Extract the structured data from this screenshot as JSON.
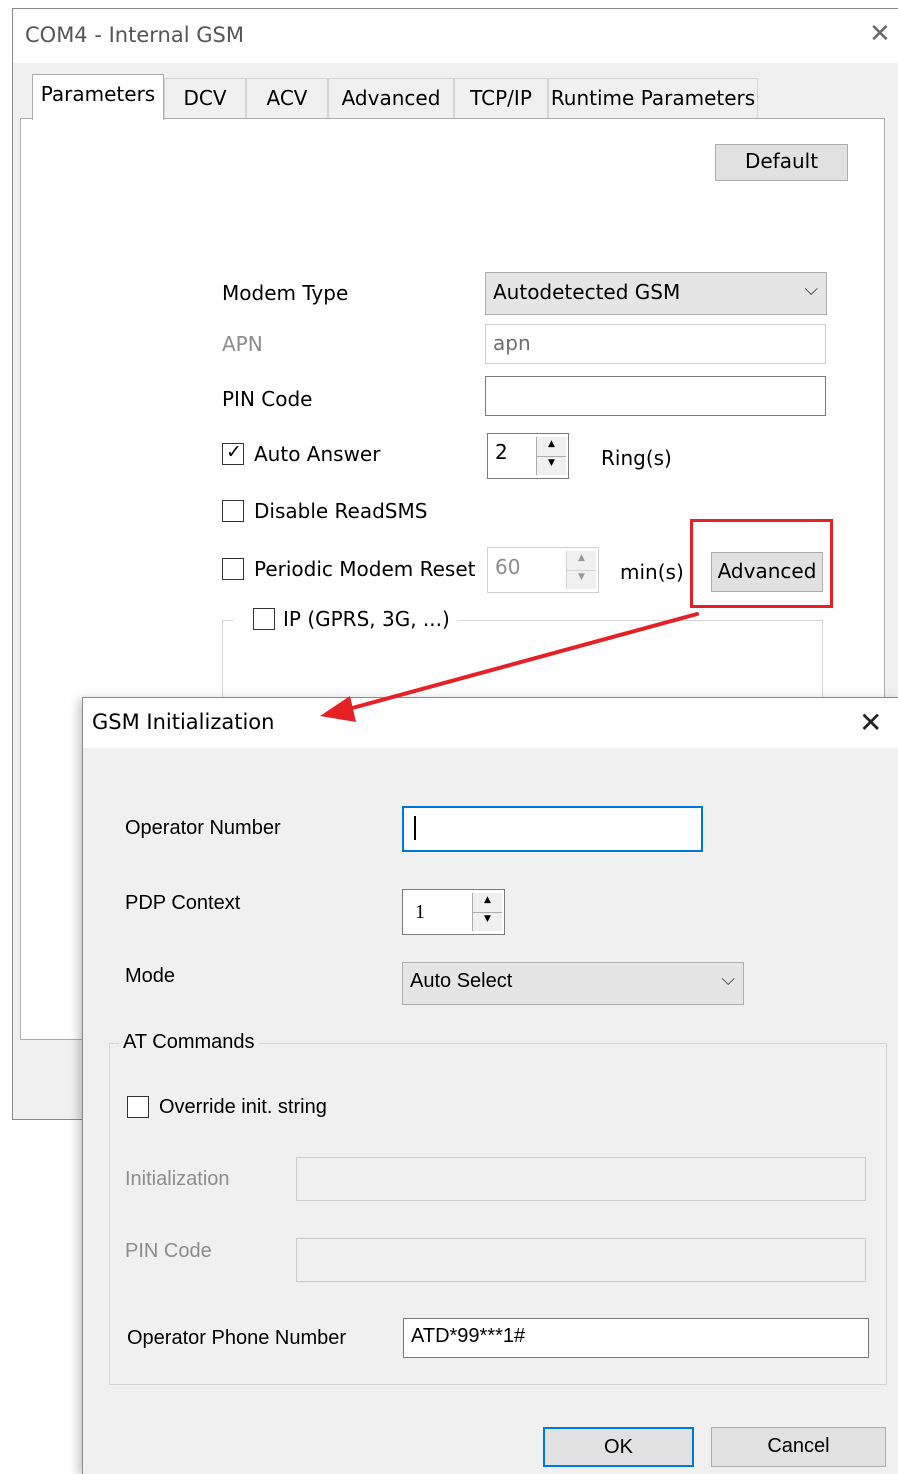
{
  "main_window": {
    "title": "COM4 - Internal GSM",
    "close_glyph": "✕",
    "tabs": [
      {
        "label": "Parameters",
        "active": true
      },
      {
        "label": "DCV"
      },
      {
        "label": "ACV"
      },
      {
        "label": "Advanced"
      },
      {
        "label": "TCP/IP"
      },
      {
        "label": "Runtime Parameters"
      }
    ],
    "default_button": "Default",
    "modem_type": {
      "label": "Modem Type",
      "value": "Autodetected GSM"
    },
    "apn": {
      "label": "APN",
      "value": "apn"
    },
    "pin_code": {
      "label": "PIN Code",
      "value": ""
    },
    "auto_answer": {
      "label": "Auto Answer",
      "checked": true,
      "value": "2",
      "unit": "Ring(s)"
    },
    "disable_readsms": {
      "label": "Disable ReadSMS",
      "checked": false
    },
    "periodic_reset": {
      "label": "Periodic Modem Reset",
      "checked": false,
      "value": "60",
      "unit": "min(s)"
    },
    "advanced_button": "Advanced",
    "ip_group": {
      "label": "IP (GPRS, 3G, ...)",
      "checked": false
    }
  },
  "dialog": {
    "title": "GSM Initialization",
    "close_glyph": "✕",
    "operator_number": {
      "label": "Operator Number",
      "value": ""
    },
    "pdp_context": {
      "label": "PDP Context",
      "value": "1"
    },
    "mode": {
      "label": "Mode",
      "value": "Auto Select"
    },
    "at_commands": {
      "title": "AT Commands",
      "override": {
        "label": "Override init. string",
        "checked": false
      },
      "initialization": {
        "label": "Initialization",
        "value": ""
      },
      "pin_code": {
        "label": "PIN Code",
        "value": ""
      },
      "operator_phone": {
        "label": "Operator Phone Number",
        "value": "ATD*99***1#"
      }
    },
    "ok_button": "OK",
    "cancel_button": "Cancel"
  },
  "annotation": {
    "color": "#e62025"
  },
  "icons": {
    "checkmark": "✓",
    "chevron": "⌵",
    "spin_up": "▲",
    "spin_down": "▼"
  }
}
